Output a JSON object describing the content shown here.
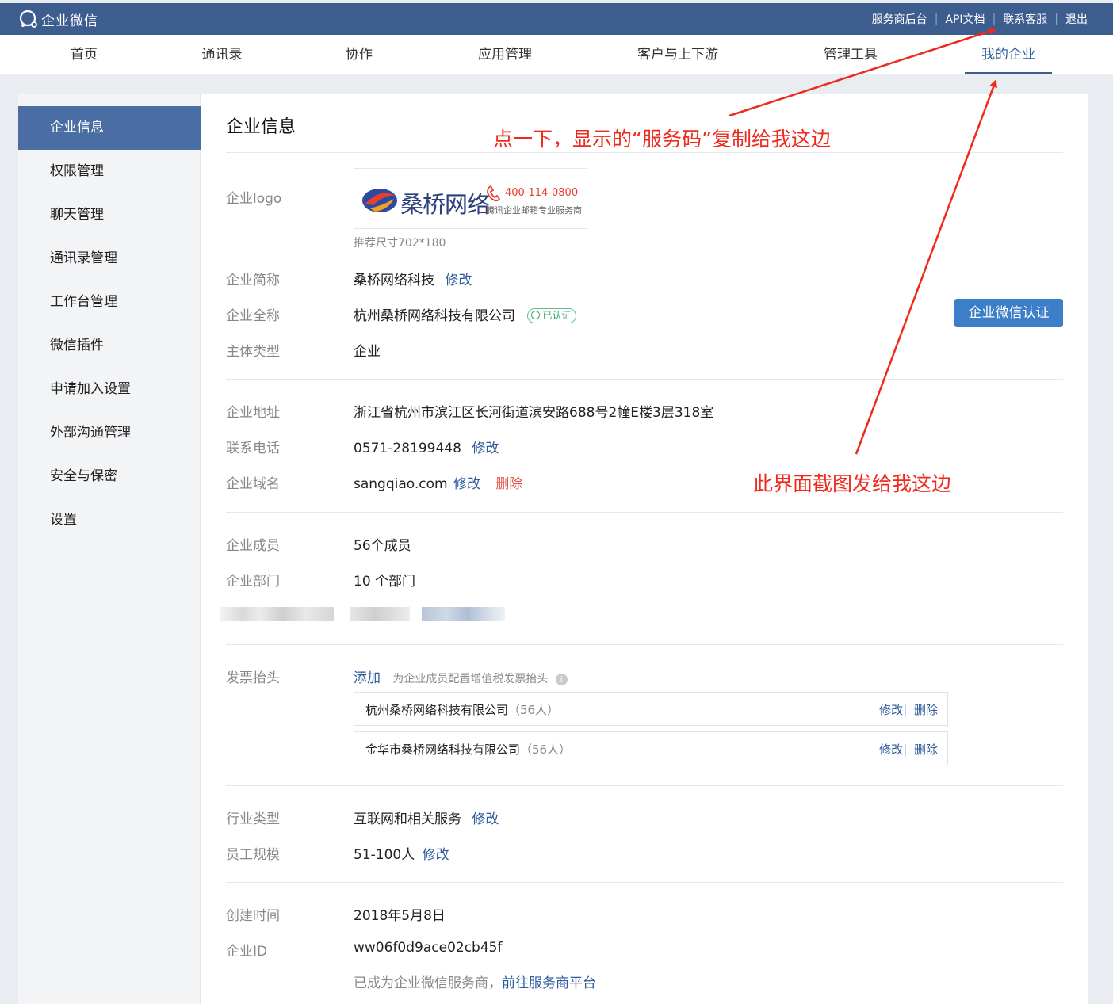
{
  "topbar": {
    "app_name": "企业微信",
    "links": [
      "服务商后台",
      "API文档",
      "联系客服",
      "退出"
    ]
  },
  "nav": {
    "items": [
      "首页",
      "通讯录",
      "协作",
      "应用管理",
      "客户与上下游",
      "管理工具",
      "我的企业"
    ],
    "active": "我的企业"
  },
  "sidebar": {
    "items": [
      "企业信息",
      "权限管理",
      "聊天管理",
      "通讯录管理",
      "工作台管理",
      "微信插件",
      "申请加入设置",
      "外部沟通管理",
      "安全与保密",
      "设置"
    ],
    "active": "企业信息"
  },
  "main": {
    "title": "企业信息",
    "logo": {
      "label": "企业logo",
      "brand": "桑桥网络",
      "phone": "400-114-0800",
      "tagline": "腾讯企业邮箱专业服务商",
      "hint": "推荐尺寸702*180"
    },
    "short_name": {
      "label": "企业简称",
      "value": "桑桥网络科技",
      "action": "修改"
    },
    "full_name": {
      "label": "企业全称",
      "value": "杭州桑桥网络科技有限公司",
      "badge": "已认证"
    },
    "auth_button": "企业微信认证",
    "entity_type": {
      "label": "主体类型",
      "value": "企业"
    },
    "address": {
      "label": "企业地址",
      "value": "浙江省杭州市滨江区长河街道滨安路688号2幢E楼3层318室"
    },
    "phone": {
      "label": "联系电话",
      "value": "0571-28199448",
      "action": "修改"
    },
    "domain": {
      "label": "企业域名",
      "value": "sangqiao.com",
      "action": "修改",
      "delete": "删除"
    },
    "members": {
      "label": "企业成员",
      "value": "56个成员"
    },
    "departments": {
      "label": "企业部门",
      "value": "10 个部门"
    },
    "invoice": {
      "label": "发票抬头",
      "add": "添加",
      "hint": "为企业成员配置增值税发票抬头",
      "items": [
        {
          "name": "杭州桑桥网络科技有限公司",
          "count": "（56人）",
          "edit": "修改",
          "delete": "删除"
        },
        {
          "name": "金华市桑桥网络科技有限公司",
          "count": "（56人）",
          "edit": "修改",
          "delete": "删除"
        }
      ]
    },
    "industry": {
      "label": "行业类型",
      "value": "互联网和相关服务",
      "action": "修改"
    },
    "scale": {
      "label": "员工规模",
      "value": "51-100人",
      "action": "修改"
    },
    "created": {
      "label": "创建时间",
      "value": "2018年5月8日"
    },
    "corp_id": {
      "label": "企业ID",
      "value": "ww06f0d9ace02cb45f"
    },
    "provider_note": "已成为企业微信服务商，",
    "provider_link": "前往服务商平台"
  },
  "annotations": {
    "top": "点一下，显示的“服务码”复制给我这边",
    "bottom": "此界面截图发给我这边"
  },
  "colors": {
    "topbar": "#3d5d8f",
    "accent": "#2e5b9a",
    "sidebar_active": "#4a6ea3",
    "button": "#3c7fc8",
    "annotation": "#ee2a1c"
  }
}
